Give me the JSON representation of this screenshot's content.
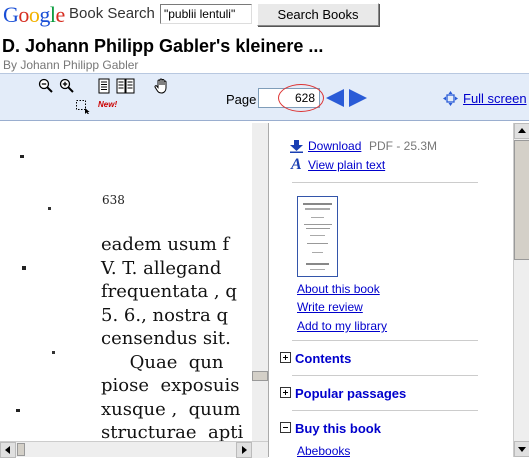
{
  "header": {
    "logo": "Google",
    "product": "Book Search",
    "search_value": "\"publii lentuli\"",
    "search_button": "Search Books"
  },
  "book": {
    "title": "D. Johann Philipp Gabler's kleinere ...",
    "author": "By Johann Philipp Gabler"
  },
  "toolbar": {
    "new_badge": "New!",
    "page_label": "Page",
    "page_value": "628",
    "fullscreen": "Full screen",
    "icons": [
      "zoom-out-icon",
      "zoom-in-icon",
      "one-page-icon",
      "two-page-icon",
      "hand-icon",
      "clip-icon",
      "prev-page-icon",
      "next-page-icon",
      "fullscreen-icon"
    ]
  },
  "viewer": {
    "page_number": "638",
    "lines": [
      "eadem usum f",
      "V. T. allegand",
      "frequentata , q",
      "5. 6., nostra q",
      "censendus sit.",
      "     Quae  qun",
      "piose  exposuis",
      "xusque ,  quum",
      "structurae  apti"
    ]
  },
  "sidebar": {
    "download": "Download",
    "download_meta": "PDF - 25.3M",
    "plain_text": "View plain text",
    "about": "About this book",
    "review": "Write review",
    "library": "Add to my library",
    "sections": [
      {
        "label": "Contents",
        "state": "collapsed"
      },
      {
        "label": "Popular passages",
        "state": "collapsed"
      },
      {
        "label": "Buy this book",
        "state": "expanded"
      }
    ],
    "buy_first": "Abebooks"
  },
  "colors": {
    "toolbar_bg": "#e3ecf9",
    "link": "#0000cc",
    "nav_arrow": "#2a5bd7",
    "highlight_circle": "#dd3333"
  }
}
